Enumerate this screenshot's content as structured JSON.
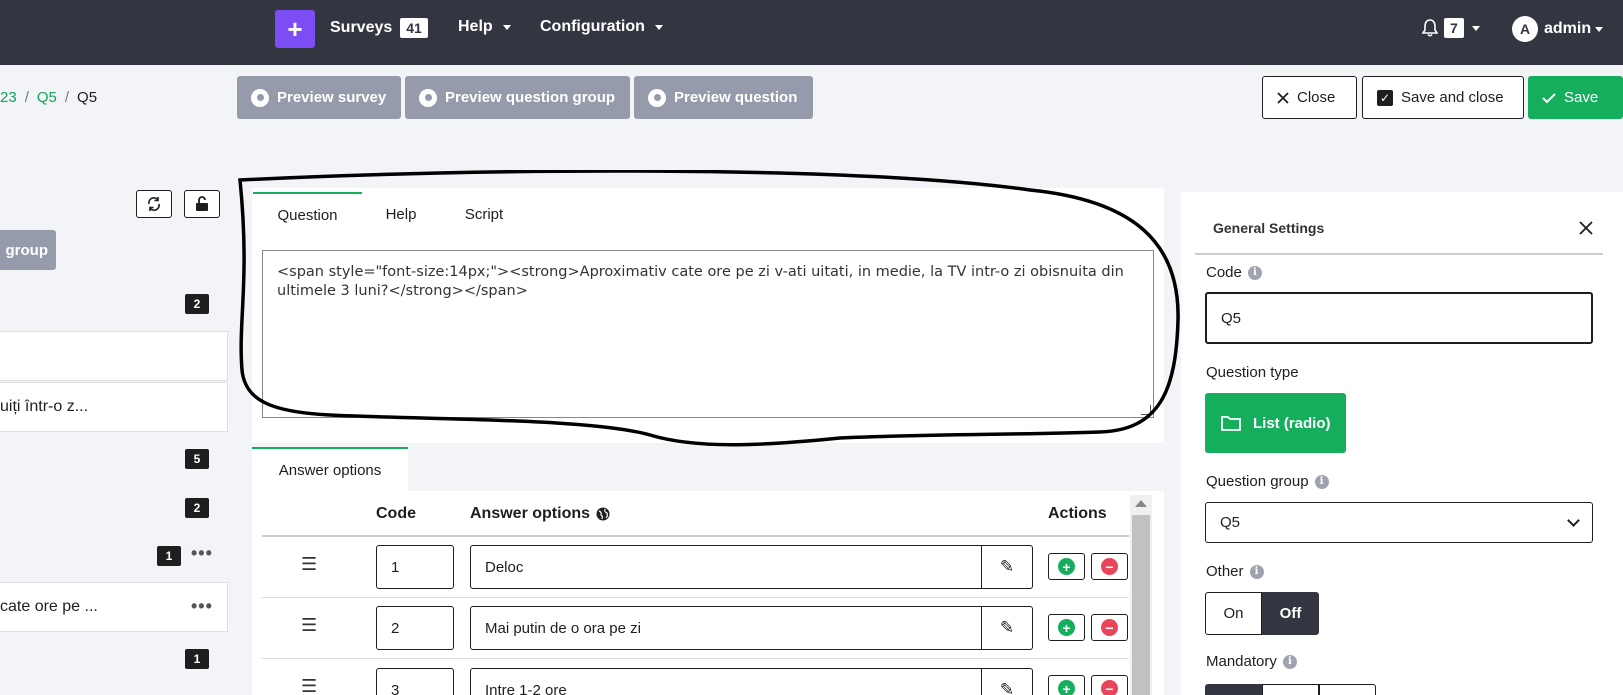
{
  "nav": {
    "plus": "+",
    "surveys_label": "Surveys",
    "surveys_count": "41",
    "help_label": "Help",
    "config_label": "Configuration",
    "notif_count": "7",
    "user_initial": "A",
    "user_name": "admin"
  },
  "breadcrumb": {
    "item1": "23",
    "sep": "/",
    "item2": "Q5",
    "current": "Q5"
  },
  "toolbar": {
    "preview_survey": "Preview survey",
    "preview_group": "Preview question group",
    "preview_question": "Preview question",
    "close": "Close",
    "save_close": "Save and close",
    "save": "Save"
  },
  "sidebar": {
    "group_label": "group",
    "items": [
      {
        "text": ""
      },
      {
        "text": "uiți într-o z..."
      },
      {
        "text": "cate ore pe ..."
      }
    ],
    "counts": [
      "2",
      "5",
      "2",
      "1",
      "1"
    ]
  },
  "editor": {
    "tabs": [
      "Question",
      "Help",
      "Script"
    ],
    "active_tab": "Question",
    "content": "<span style=\"font-size:14px;\"><strong>Aproximativ cate ore pe zi v-ati uitati, in medie, la TV intr-o zi obisnuita din ultimele 3 luni?</strong></span>"
  },
  "answers": {
    "tab_label": "Answer options",
    "col_code": "Code",
    "col_options": "Answer options",
    "col_actions": "Actions",
    "rows": [
      {
        "code": "1",
        "text": "Deloc"
      },
      {
        "code": "2",
        "text": "Mai putin de o ora pe zi"
      },
      {
        "code": "3",
        "text": "Intre 1-2 ore"
      }
    ]
  },
  "settings": {
    "title": "General Settings",
    "code_label": "Code",
    "code_value": "Q5",
    "type_label": "Question type",
    "type_value": "List (radio)",
    "group_label": "Question group",
    "group_value": "Q5",
    "other_label": "Other",
    "on_label": "On",
    "off_label": "Off",
    "mandatory_label": "Mandatory"
  },
  "colors": {
    "nav_bg": "#333641",
    "accent_purple": "#7c4cf4",
    "green": "#14ae5c",
    "preview_gray": "#969bab",
    "danger": "#e8455a"
  }
}
